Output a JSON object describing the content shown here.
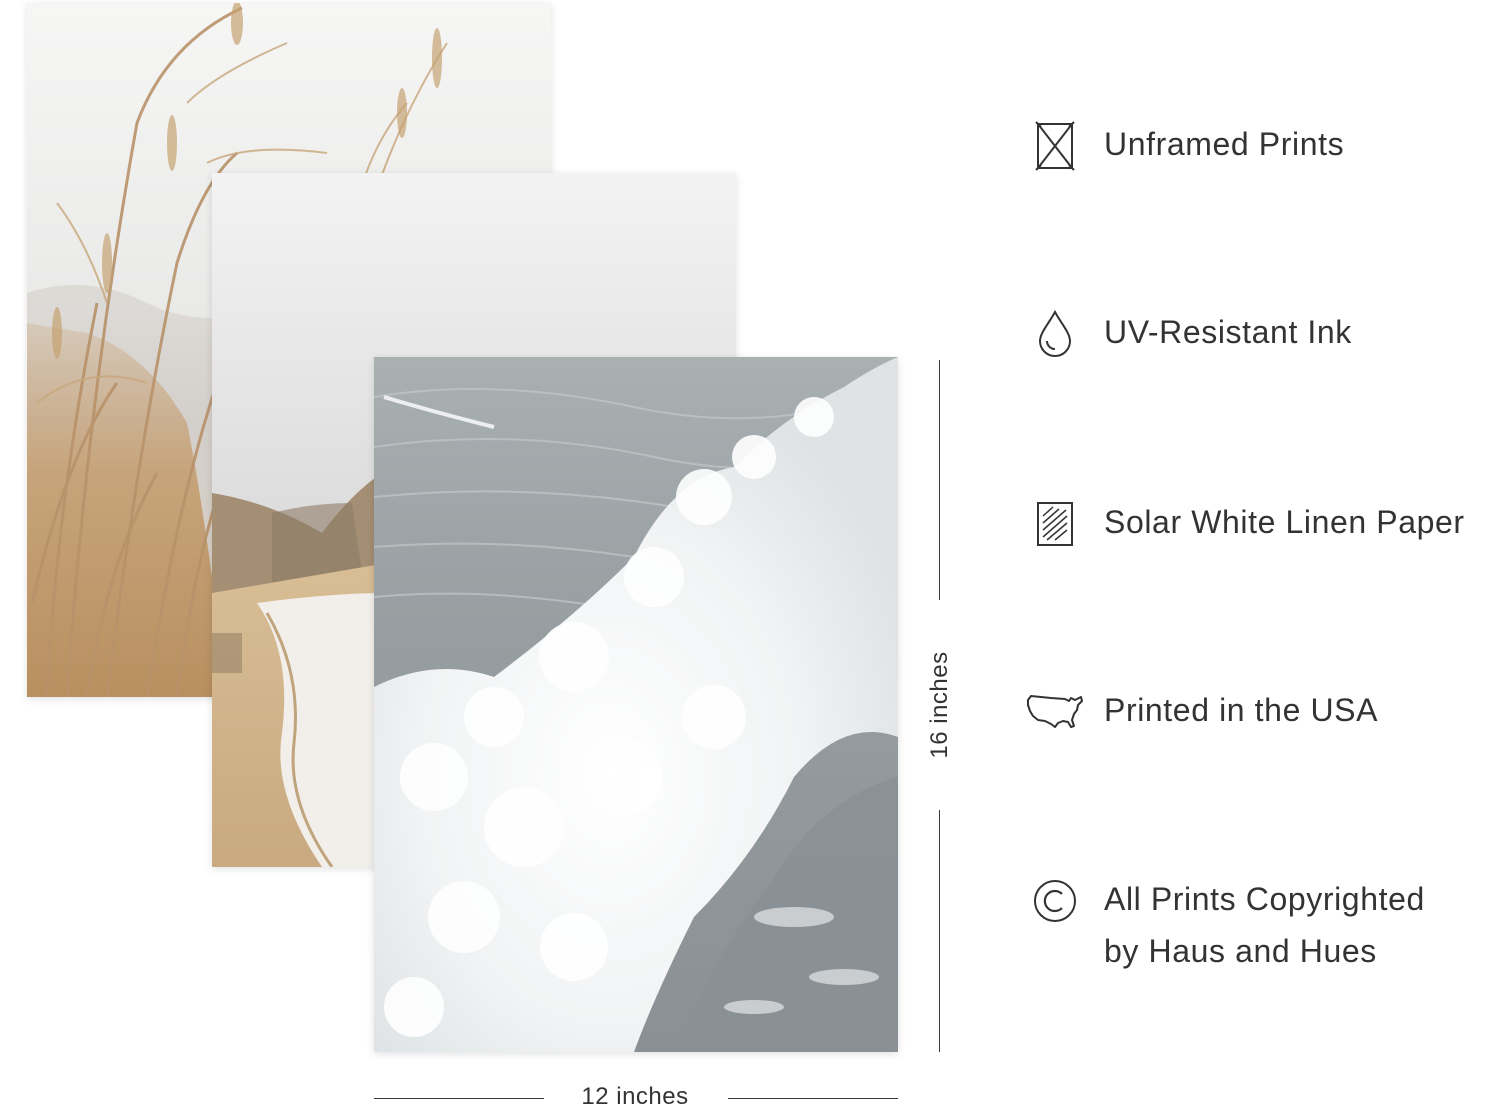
{
  "prints": [
    {
      "subject": "dry beach grass against overcast sky"
    },
    {
      "subject": "sandy coastline with cliffs under grey sky"
    },
    {
      "subject": "crashing white ocean wave"
    }
  ],
  "dimensions": {
    "height_label": "16 inches",
    "width_label": "12 inches"
  },
  "features": [
    {
      "icon": "unframed-icon",
      "label": "Unframed Prints"
    },
    {
      "icon": "ink-drop-icon",
      "label": "UV-Resistant Ink"
    },
    {
      "icon": "linen-paper-icon",
      "label": "Solar White Linen Paper"
    },
    {
      "icon": "usa-map-icon",
      "label": "Printed in the USA"
    },
    {
      "icon": "copyright-icon",
      "label_line1": "All Prints Copyrighted",
      "label_line2": "by Haus and Hues"
    }
  ],
  "colors": {
    "text": "#333333",
    "background": "#ffffff",
    "grass": "#c8a67a",
    "sea": "#8e969a"
  }
}
